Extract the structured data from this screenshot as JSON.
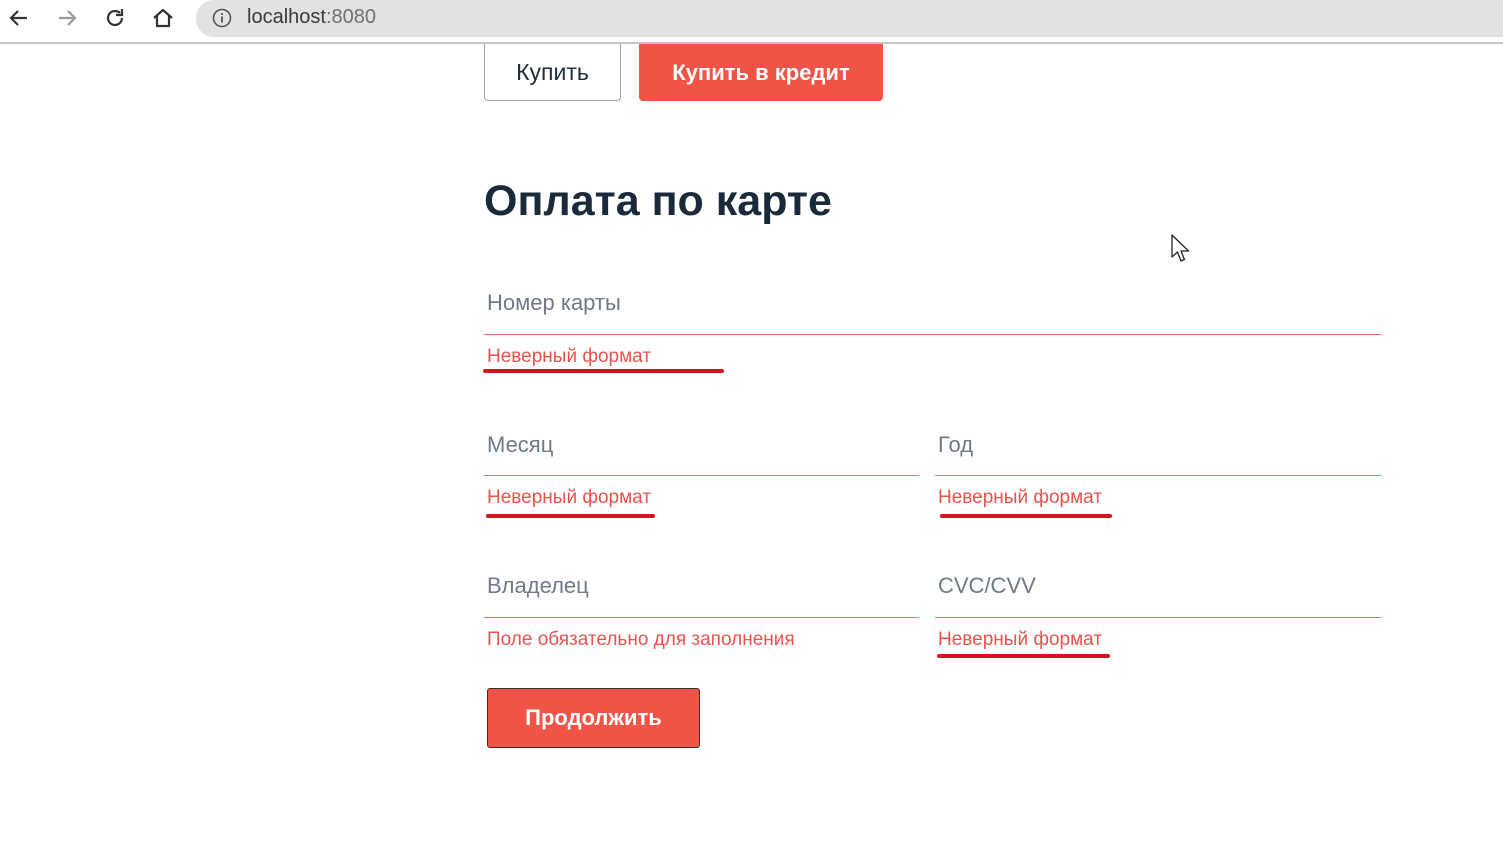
{
  "browser": {
    "url_host": "localhost",
    "url_port": ":8080"
  },
  "buttons": {
    "buy": "Купить",
    "buy_credit": "Купить в кредит",
    "continue": "Продолжить"
  },
  "form": {
    "title": "Оплата по карте",
    "card_number": {
      "label": "Номер карты",
      "error": "Неверный формат"
    },
    "month": {
      "label": "Месяц",
      "error": "Неверный формат"
    },
    "year": {
      "label": "Год",
      "error": "Неверный формат"
    },
    "owner": {
      "label": "Владелец",
      "error": "Поле обязательно для заполнения"
    },
    "cvc": {
      "label": "CVC/CVV",
      "error": "Неверный формат"
    }
  },
  "colors": {
    "accent_red": "#f05447",
    "error_text": "#e9534d",
    "annotation": "#d4141f",
    "title": "#1b2a3b"
  }
}
